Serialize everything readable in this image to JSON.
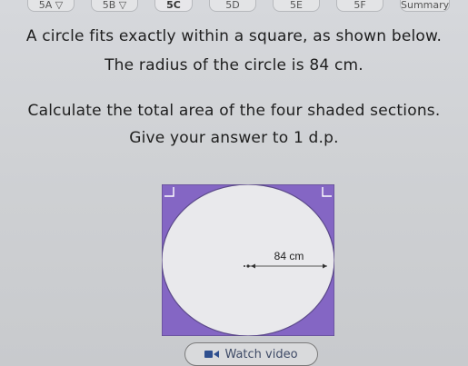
{
  "tabs": [
    {
      "label": "5A ▽"
    },
    {
      "label": "5B ▽"
    },
    {
      "label": "5C"
    },
    {
      "label": "5D"
    },
    {
      "label": "5E"
    },
    {
      "label": "5F"
    },
    {
      "label": "Summary"
    }
  ],
  "question": {
    "line1": "A circle fits exactly within a square, as shown below.",
    "line2": "The radius of the circle is 84 cm.",
    "line3": "Calculate the total area of the four shaded sections.",
    "line4": "Give your answer to 1 d.p."
  },
  "diagram": {
    "radius_label": "84 cm",
    "shade_color": "#8466c4",
    "circle_color": "#e9e9ec"
  },
  "watch_video": {
    "label": "Watch video"
  }
}
